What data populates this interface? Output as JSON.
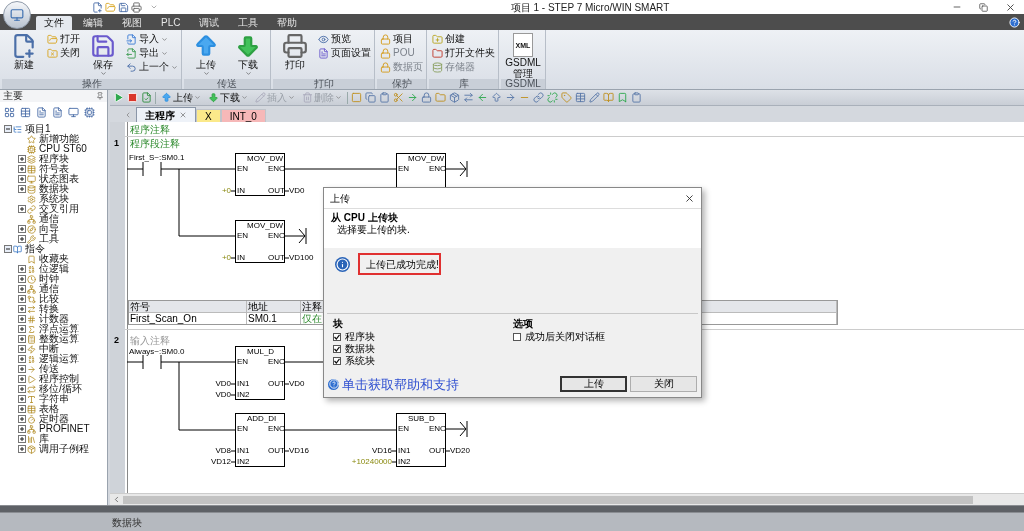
{
  "window": {
    "title": "项目 1 - STEP 7 Micro/WIN SMART"
  },
  "menu_tabs": [
    {
      "label": "文件",
      "selected": true
    },
    {
      "label": "编辑",
      "selected": false
    },
    {
      "label": "视图",
      "selected": false
    },
    {
      "label": "PLC",
      "selected": false
    },
    {
      "label": "调试",
      "selected": false
    },
    {
      "label": "工具",
      "selected": false
    },
    {
      "label": "帮助",
      "selected": false
    }
  ],
  "ribbon": {
    "groups": [
      {
        "label": "操作",
        "items": [
          {
            "kind": "large",
            "label": "新建",
            "dropdown": false
          },
          {
            "kind": "column",
            "buttons": [
              {
                "label": "打开",
                "disabled": false,
                "dropdown": false
              },
              {
                "label": "关闭",
                "disabled": false,
                "dropdown": false
              }
            ]
          },
          {
            "kind": "large",
            "label": "保存",
            "dropdown": true
          },
          {
            "kind": "column",
            "buttons": [
              {
                "label": "导入",
                "disabled": false,
                "dropdown": true
              },
              {
                "label": "导出",
                "disabled": false,
                "dropdown": true
              },
              {
                "label": "上一个",
                "disabled": false,
                "dropdown": true
              }
            ]
          }
        ]
      },
      {
        "label": "传送",
        "items": [
          {
            "kind": "large",
            "label": "上传",
            "dropdown": true
          },
          {
            "kind": "large",
            "label": "下载",
            "dropdown": true
          }
        ]
      },
      {
        "label": "打印",
        "items": [
          {
            "kind": "large",
            "label": "打印",
            "dropdown": false
          },
          {
            "kind": "column",
            "buttons": [
              {
                "label": "预览",
                "disabled": false,
                "dropdown": false
              },
              {
                "label": "页面设置",
                "disabled": false,
                "dropdown": false
              }
            ]
          }
        ]
      },
      {
        "label": "保护",
        "items": [
          {
            "kind": "column",
            "buttons": [
              {
                "label": "项目",
                "disabled": false,
                "dropdown": false
              },
              {
                "label": "POU",
                "disabled": true,
                "dropdown": false
              },
              {
                "label": "数据页",
                "disabled": true,
                "dropdown": false
              }
            ]
          }
        ]
      },
      {
        "label": "库",
        "items": [
          {
            "kind": "column",
            "buttons": [
              {
                "label": "创建",
                "disabled": false,
                "dropdown": false
              },
              {
                "label": "打开文件夹",
                "disabled": false,
                "dropdown": false
              },
              {
                "label": "存储器",
                "disabled": true,
                "dropdown": false
              }
            ]
          }
        ]
      },
      {
        "label": "GSDML",
        "items": [
          {
            "kind": "large",
            "label": "GSDML 管理",
            "badge": "XML",
            "dropdown": false
          }
        ]
      }
    ]
  },
  "navigator": {
    "title": "主要",
    "tree": [
      {
        "label": "项目1",
        "expanded": true,
        "children": [
          {
            "label": "新增功能"
          },
          {
            "label": "CPU ST60"
          },
          {
            "label": "程序块",
            "expanded": false
          },
          {
            "label": "符号表",
            "expanded": false
          },
          {
            "label": "状态图表",
            "expanded": false
          },
          {
            "label": "数据块",
            "expanded": false
          },
          {
            "label": "系统块"
          },
          {
            "label": "交叉引用",
            "expanded": false
          },
          {
            "label": "通信"
          },
          {
            "label": "向导",
            "expanded": false
          },
          {
            "label": "工具",
            "expanded": false
          }
        ]
      },
      {
        "label": "指令",
        "expanded": true,
        "children": [
          {
            "label": "收藏夹"
          },
          {
            "label": "位逻辑",
            "expanded": false
          },
          {
            "label": "时钟",
            "expanded": false
          },
          {
            "label": "通信",
            "expanded": false
          },
          {
            "label": "比较",
            "expanded": false
          },
          {
            "label": "转换",
            "expanded": false
          },
          {
            "label": "计数器",
            "expanded": false
          },
          {
            "label": "浮点运算",
            "expanded": false
          },
          {
            "label": "整数运算",
            "expanded": false
          },
          {
            "label": "中断",
            "expanded": false
          },
          {
            "label": "逻辑运算",
            "expanded": false
          },
          {
            "label": "传送",
            "expanded": false
          },
          {
            "label": "程序控制",
            "expanded": false
          },
          {
            "label": "移位/循环",
            "expanded": false
          },
          {
            "label": "字符串",
            "expanded": false
          },
          {
            "label": "表格",
            "expanded": false
          },
          {
            "label": "定时器",
            "expanded": false
          },
          {
            "label": "PROFINET",
            "expanded": false
          },
          {
            "label": "库",
            "expanded": false
          },
          {
            "label": "调用子例程",
            "expanded": false
          }
        ]
      }
    ]
  },
  "editor_toolbar": [
    {
      "label": "上传",
      "disabled": false
    },
    {
      "label": "下载",
      "disabled": false
    },
    {
      "label": "插入",
      "disabled": true
    },
    {
      "label": "删除",
      "disabled": true
    }
  ],
  "editor_tabs": [
    {
      "label": "主程序",
      "selected": true,
      "color": "#eef2f8"
    },
    {
      "label": "X",
      "selected": false,
      "color": "#fbe98a"
    },
    {
      "label": "INT_0",
      "selected": false,
      "color": "#f6b8b8"
    }
  ],
  "program_comment": "程序注释",
  "networks": [
    {
      "number": "1",
      "comment": "程序段注释",
      "comment_empty": false,
      "contact": "First_S~:SM0.1",
      "blocks": [
        {
          "name": "MOV_DW",
          "en": "EN",
          "eno": "ENO",
          "open_end": false,
          "inputs": [
            {
              "pin": "IN",
              "value": "+0",
              "kind": "constant"
            }
          ],
          "outputs": [
            {
              "pin": "OUT",
              "value": "VD0"
            }
          ]
        },
        {
          "name": "MOV_DW",
          "en": "EN",
          "eno": "ENO",
          "open_end": true
        },
        {
          "name": "MOV_DW",
          "en": "EN",
          "eno": "ENO",
          "open_end": true,
          "inputs": [
            {
              "pin": "IN",
              "value": "+0",
              "kind": "constant"
            }
          ],
          "outputs": [
            {
              "pin": "OUT",
              "value": "VD100"
            }
          ]
        }
      ],
      "symbol_table": {
        "columns": [
          "符号",
          "地址",
          "注释"
        ],
        "rows": [
          [
            "First_Scan_On",
            "SM0.1",
            "仅在"
          ]
        ]
      }
    },
    {
      "number": "2",
      "comment": "输入注释",
      "comment_empty": true,
      "contact": "Always~:SM0.0",
      "blocks": [
        {
          "name": "MUL_D",
          "en": "EN",
          "eno": "ENO",
          "open_end": false,
          "inputs": [
            {
              "pin": "IN1",
              "value": "VD0",
              "kind": "address"
            },
            {
              "pin": "IN2",
              "value": "VD0",
              "kind": "address"
            }
          ],
          "outputs": [
            {
              "pin": "OUT",
              "value": "VD0"
            }
          ]
        },
        {
          "name": "ADD_DI",
          "en": "EN",
          "eno": "ENO",
          "open_end": false,
          "inputs": [
            {
              "pin": "IN1",
              "value": "VD8",
              "kind": "address"
            },
            {
              "pin": "IN2",
              "value": "VD12",
              "kind": "address"
            }
          ],
          "outputs": [
            {
              "pin": "OUT",
              "value": "VD16"
            }
          ]
        },
        {
          "name": "SUB_D",
          "en": "EN",
          "eno": "ENO",
          "open_end": true,
          "inputs": [
            {
              "pin": "IN1",
              "value": "VD16",
              "kind": "address"
            },
            {
              "pin": "IN2",
              "value": "+10240000",
              "kind": "constant"
            }
          ],
          "outputs": [
            {
              "pin": "OUT",
              "value": "VD20"
            }
          ]
        }
      ]
    }
  ],
  "dialog": {
    "title": "上传",
    "heading": "从 CPU 上传块",
    "subheading": "选择要上传的块.",
    "message": "上传已成功完成!",
    "message_highlighted": true,
    "blocks_label": "块",
    "blocks": [
      {
        "label": "程序块",
        "checked": true
      },
      {
        "label": "数据块",
        "checked": true
      },
      {
        "label": "系统块",
        "checked": true
      }
    ],
    "options_label": "选项",
    "options": [
      {
        "label": "成功后关闭对话框",
        "checked": false
      }
    ],
    "help_link": "单击获取帮助和支持",
    "buttons": [
      {
        "label": "上传",
        "default": true
      },
      {
        "label": "关闭",
        "default": false
      }
    ]
  },
  "bottom_panel": {
    "title": "数据块"
  }
}
